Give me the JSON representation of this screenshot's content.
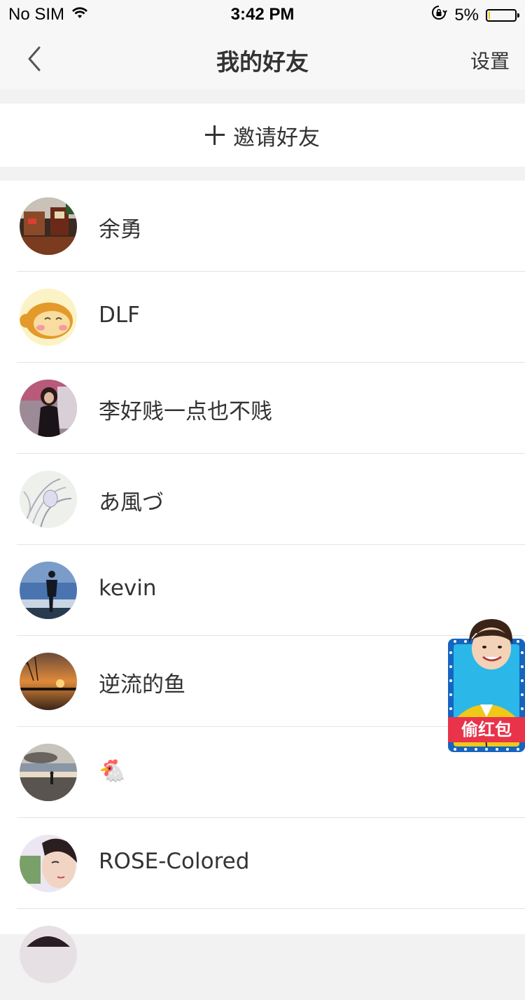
{
  "status_bar": {
    "carrier": "No SIM",
    "time": "3:42 PM",
    "battery_text": "5%",
    "battery_level": 0.05
  },
  "nav": {
    "title": "我的好友",
    "settings_label": "设置",
    "back_icon": "chevron-left-icon"
  },
  "invite": {
    "label": "邀请好友",
    "icon": "plus-icon"
  },
  "friends": [
    {
      "name": "余勇"
    },
    {
      "name": "DLF"
    },
    {
      "name": "李好贱一点也不贱"
    },
    {
      "name": "あ風づ"
    },
    {
      "name": "kevin"
    },
    {
      "name": "逆流的鱼"
    },
    {
      "name": "🐔"
    },
    {
      "name": "ROSE-Colored"
    }
  ],
  "red_packet": {
    "label": "偷红包"
  },
  "colors": {
    "background": "#f2f2f2",
    "nav_background": "#f7f7f7",
    "text": "#333333",
    "red_packet_label": "#e8334a",
    "red_packet_frame": "#1565c0"
  }
}
